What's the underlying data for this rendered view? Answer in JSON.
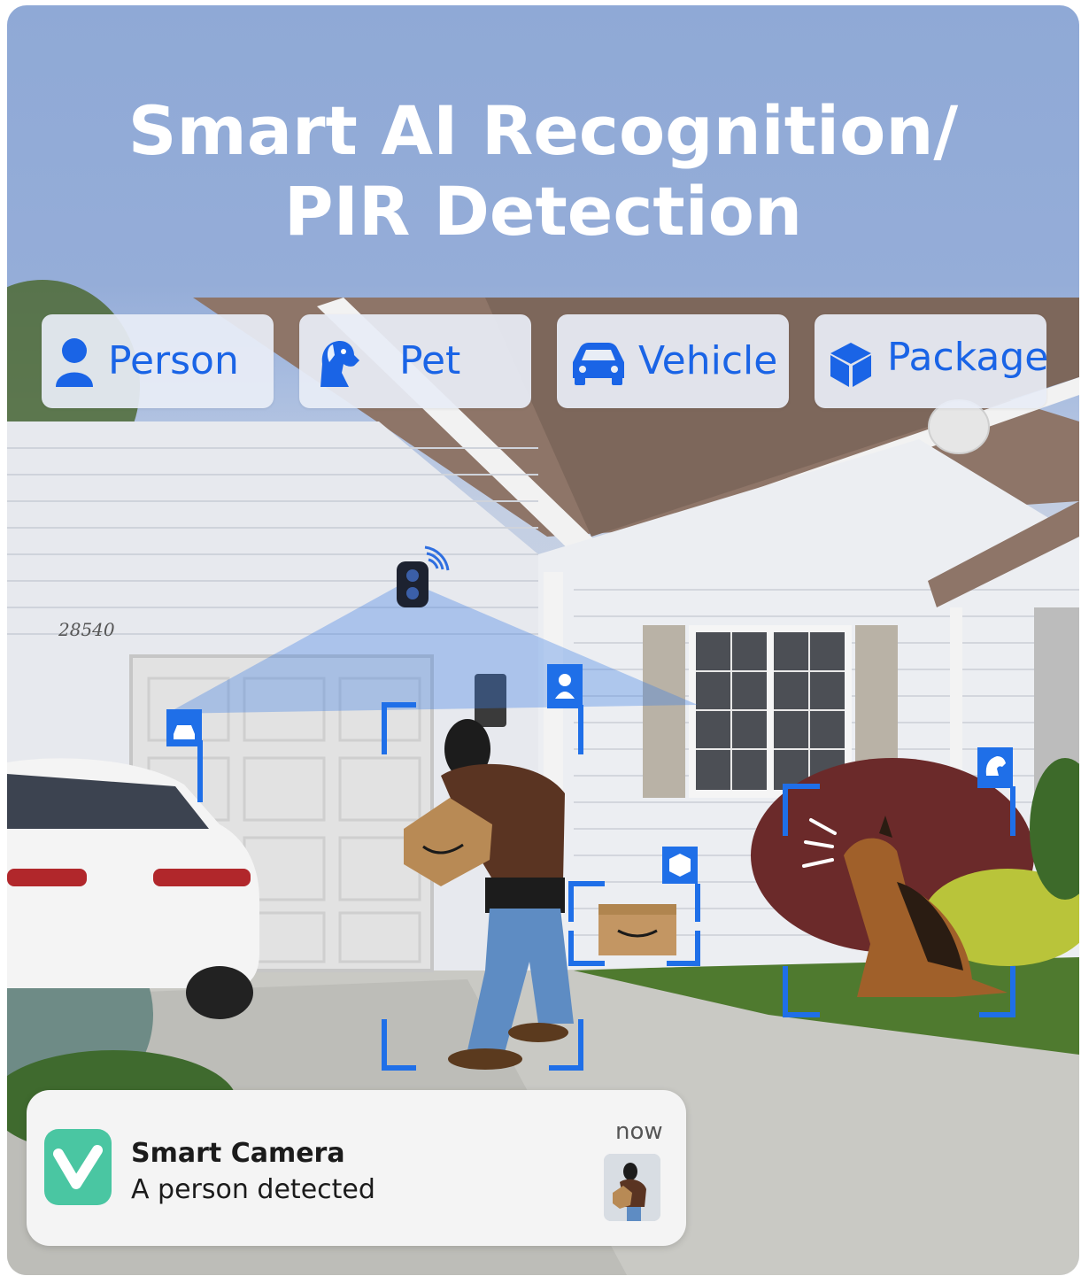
{
  "title": {
    "line1": "Smart AI Recognition/",
    "line2": "PIR Detection"
  },
  "detection_types": [
    {
      "label": "Person",
      "icon": "person-icon"
    },
    {
      "label": "Pet",
      "icon": "dog-icon"
    },
    {
      "label": "Vehicle",
      "icon": "car-icon"
    },
    {
      "label": "Package",
      "icon": "package-icon"
    }
  ],
  "house_number": "28540",
  "notification": {
    "app_name": "Smart Camera",
    "message": "A person detected",
    "time": "now",
    "app_icon": "V"
  },
  "colors": {
    "accent": "#1a64e6",
    "marker": "#1f6fe8",
    "app_icon": "#4ac6a2"
  }
}
